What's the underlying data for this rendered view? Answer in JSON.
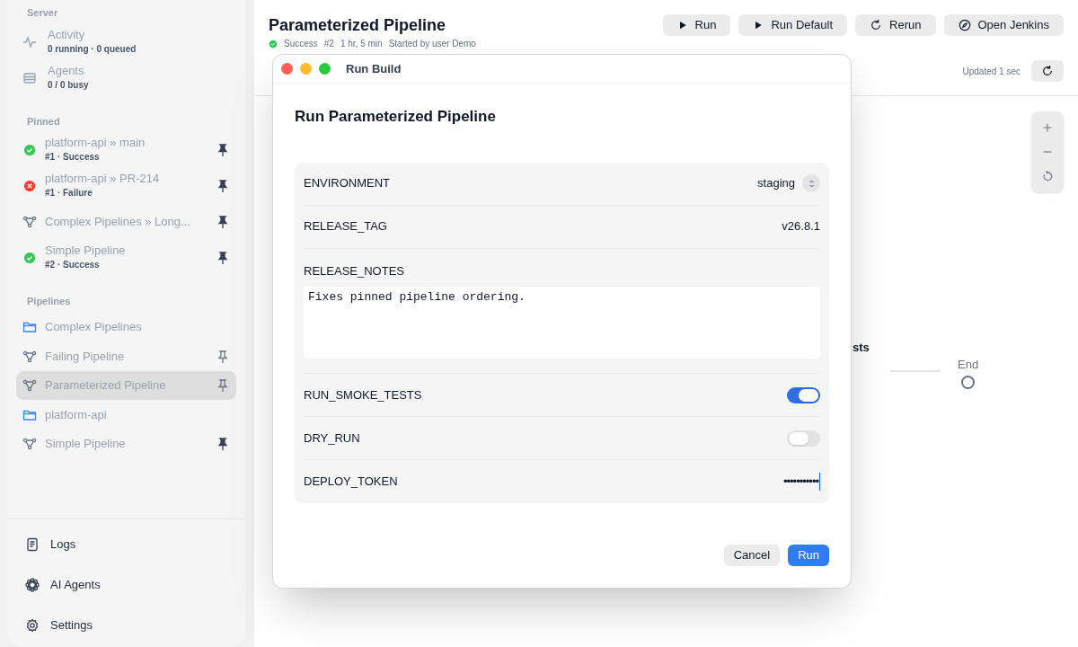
{
  "sidebar": {
    "server_heading": "Server",
    "server_items": [
      {
        "kind": "activity",
        "title": "Activity",
        "subtitle": "0 running · 0 queued"
      },
      {
        "kind": "agents",
        "title": "Agents",
        "subtitle": "0 / 0 busy"
      }
    ],
    "pinned_heading": "Pinned",
    "pinned_items": [
      {
        "kind": "success",
        "title": "platform-api » main",
        "subtitle": "#1 · Success",
        "pinned": true
      },
      {
        "kind": "failure",
        "title": "platform-api » PR-214",
        "subtitle": "#1 · Failure",
        "pinned": true
      },
      {
        "kind": "pipeline",
        "title": "Complex Pipelines » Long...",
        "pinned": true
      },
      {
        "kind": "success",
        "title": "Simple Pipeline",
        "subtitle": "#2 · Success",
        "pinned": true
      }
    ],
    "pipelines_heading": "Pipelines",
    "pipeline_items": [
      {
        "kind": "folder",
        "title": "Complex Pipelines",
        "selected": false
      },
      {
        "kind": "pipeline",
        "title": "Failing Pipeline",
        "pinned": false,
        "selected": false
      },
      {
        "kind": "pipeline",
        "title": "Parameterized Pipeline",
        "pinned": false,
        "selected": true
      },
      {
        "kind": "folder",
        "title": "platform-api",
        "selected": false
      },
      {
        "kind": "pipeline",
        "title": "Simple Pipeline",
        "pinned": true,
        "selected": false
      }
    ],
    "footer_items": [
      {
        "kind": "logs",
        "label": "Logs"
      },
      {
        "kind": "agents",
        "label": "AI Agents"
      },
      {
        "kind": "settings",
        "label": "Settings"
      }
    ]
  },
  "header": {
    "title": "Parameterized Pipeline",
    "status": "Success",
    "build": "#2",
    "duration": "1 hr, 5 min",
    "cause": "Started by user Demo",
    "buttons": [
      {
        "kind": "play",
        "label": "Run"
      },
      {
        "kind": "play",
        "label": "Run Default"
      },
      {
        "kind": "rerun",
        "label": "Rerun"
      },
      {
        "kind": "compass",
        "label": "Open Jenkins"
      }
    ],
    "updated": "Updated 1 sec"
  },
  "graph": {
    "stage_label": "sts",
    "end_label": "End"
  },
  "dialog": {
    "window_title": "Run Build",
    "heading": "Run Parameterized Pipeline",
    "params": [
      {
        "kind": "select",
        "name": "ENVIRONMENT",
        "value": "staging"
      },
      {
        "kind": "text",
        "name": "RELEASE_TAG",
        "value": "v26.8.1"
      },
      {
        "kind": "textarea",
        "name": "RELEASE_NOTES",
        "value": "Fixes pinned pipeline ordering."
      },
      {
        "kind": "toggle",
        "name": "RUN_SMOKE_TESTS",
        "on": true
      },
      {
        "kind": "toggle",
        "name": "DRY_RUN",
        "on": false
      },
      {
        "kind": "password",
        "name": "DEPLOY_TOKEN",
        "value": "•••••••••••"
      }
    ],
    "buttons": [
      {
        "kind": "secondary",
        "label": "Cancel"
      },
      {
        "kind": "primary",
        "label": "Run"
      }
    ]
  }
}
